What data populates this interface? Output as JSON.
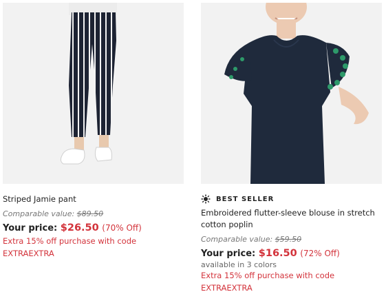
{
  "products": [
    {
      "name": "Striped Jamie pant",
      "comparable_label": "Comparable value:",
      "comparable_value": "$89.50",
      "price_label": "Your price:",
      "price": "$26.50",
      "discount": "(70% Off)",
      "promo_line1": "Extra 15% off purchase with code",
      "promo_line2": "EXTRAEXTRA"
    },
    {
      "badge_icon": "sparkle-icon",
      "badge": "BEST SELLER",
      "name": "Embroidered flutter-sleeve blouse in stretch cotton poplin",
      "comparable_label": "Comparable value:",
      "comparable_value": "$59.50",
      "price_label": "Your price:",
      "price": "$16.50",
      "discount": "(72% Off)",
      "colors": "available in 3 colors",
      "promo_line1": "Extra 15% off purchase with code",
      "promo_line2": "EXTRAEXTRA"
    }
  ]
}
